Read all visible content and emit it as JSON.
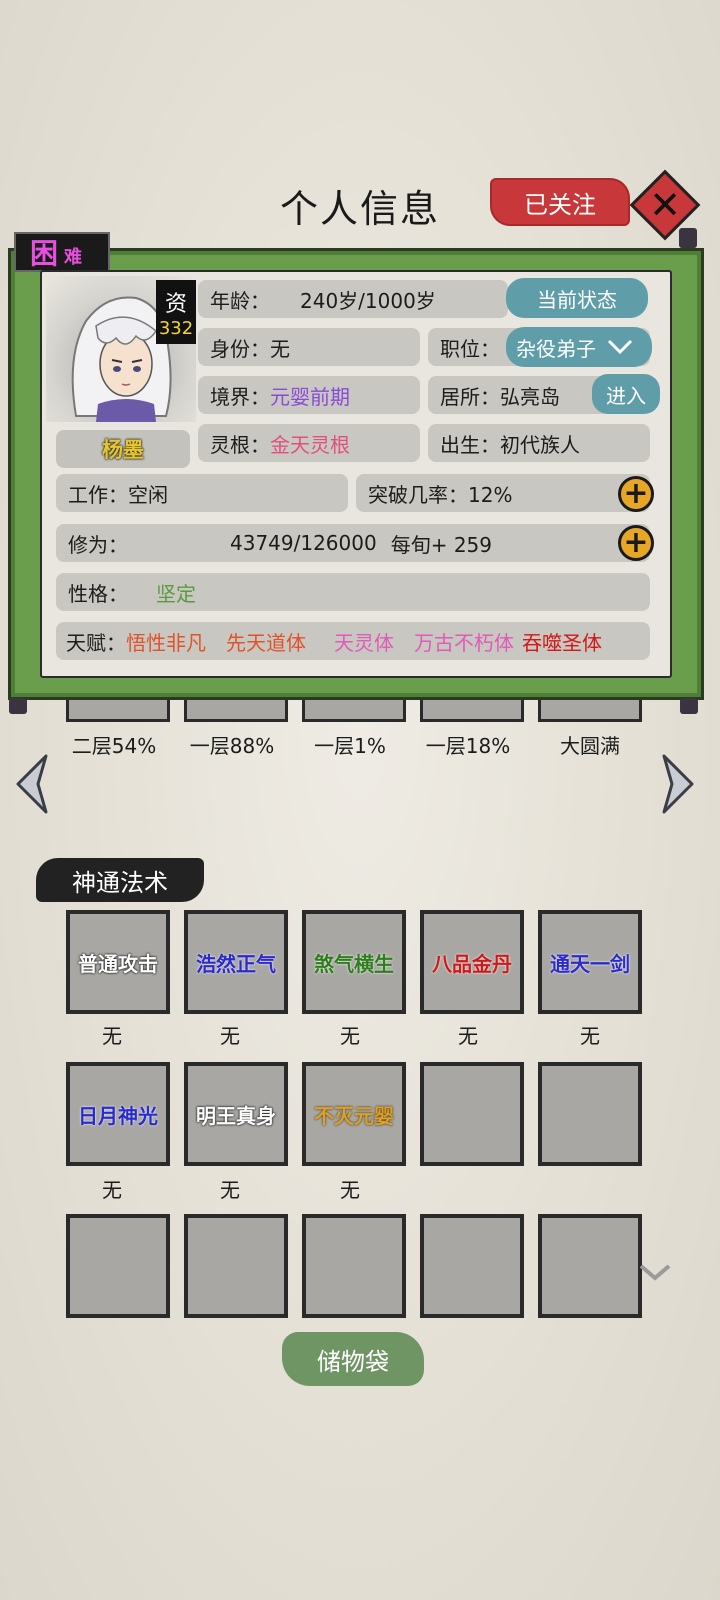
{
  "header": {
    "title": "个人信息",
    "follow_label": "已关注",
    "close_icon": "close-icon"
  },
  "difficulty": {
    "main": "困",
    "sub": "难"
  },
  "character": {
    "name": "杨墨",
    "qualification_label": "资",
    "qualification_value": "332",
    "age_label": "年龄：",
    "age_value": "240岁/1000岁",
    "status_button": "当前状态",
    "identity": "身份：无",
    "position_label": "职位：",
    "position_value": "杂役弟子",
    "realm_label": "境界：",
    "realm_value": "元婴前期",
    "residence": "居所：弘亮岛",
    "enter_button": "进入",
    "root_label": "灵根：",
    "root_value": "金天灵根",
    "birth": "出生：初代族人",
    "work": "工作：空闲",
    "breakthrough": "突破几率：12%",
    "cultivation_label": "修为：",
    "cultivation_value": "43749/126000",
    "cultivation_rate": "每旬+ 259",
    "personality_label": "性格：",
    "personality_value": "坚定",
    "talent_label": "天赋：",
    "talents": [
      "悟性非凡",
      "先天道体",
      "天灵体",
      "万古不朽体",
      "吞噬圣体"
    ]
  },
  "cultivation_levels": [
    "二层54%",
    "一层88%",
    "一层1%",
    "一层18%",
    "大圆满"
  ],
  "skills_section": {
    "title": "神通法术",
    "slots": [
      {
        "name": "普通攻击",
        "level": "无",
        "color": "#ffffff"
      },
      {
        "name": "浩然正气",
        "level": "无",
        "color": "#2a2ad0"
      },
      {
        "name": "煞气横生",
        "level": "无",
        "color": "#2e7d1e"
      },
      {
        "name": "八品金丹",
        "level": "无",
        "color": "#d01818"
      },
      {
        "name": "通天一剑",
        "level": "无",
        "color": "#2a2ad0"
      },
      {
        "name": "日月神光",
        "level": "无",
        "color": "#2a2ad0"
      },
      {
        "name": "明王真身",
        "level": "无",
        "color": "#ffffff"
      },
      {
        "name": "不灭元婴",
        "level": "无",
        "color": "#e0a020"
      }
    ]
  },
  "storage_button": "储物袋",
  "colors": {
    "accent_red": "#c8383a",
    "teal": "#5f9ea8",
    "scroll_green": "#6a9e4c"
  }
}
